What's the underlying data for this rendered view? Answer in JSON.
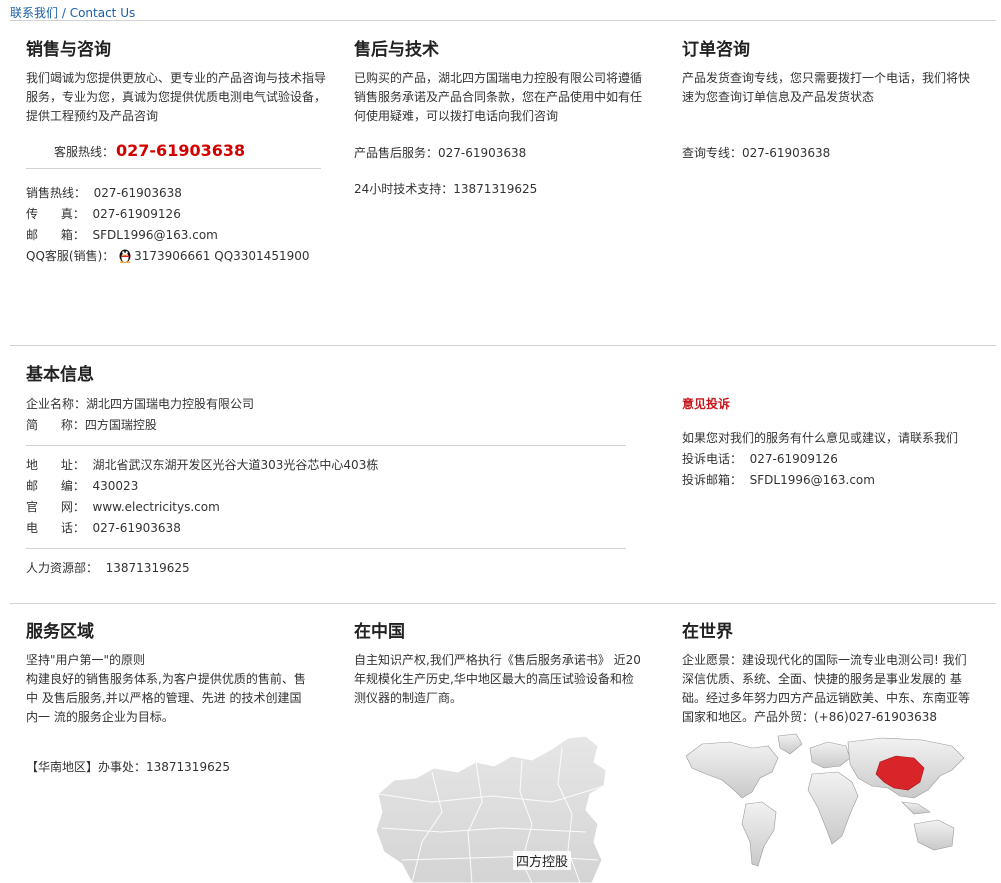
{
  "breadcrumb": {
    "cn": "联系我们",
    "sep": " / ",
    "en": "Contact Us"
  },
  "sales": {
    "title": "销售与咨询",
    "intro": "我们竭诚为您提供更放心、更专业的产品咨询与技术指导服务，专业为您，真诚为您提供优质电测电气试验设备，提供工程预约及产品咨询",
    "hotline_label": "客服热线：",
    "hotline_number": "027-61903638",
    "lines": [
      "销售热线：  027-61903638",
      "传      真：  027-61909126",
      "邮      箱：  SFDL1996@163.com"
    ],
    "qq_label": "QQ客服(销售)：",
    "qq_numbers": "3173906661 QQ3301451900"
  },
  "aftersales": {
    "title": "售后与技术",
    "intro": "已购买的产品，湖北四方国瑞电力控股有限公司将遵循销售服务承诺及产品合同条款，您在产品使用中如有任何使用疑难，可以拨打电话向我们咨询",
    "service": "产品售后服务：027-61903638",
    "support": "24小时技术支持：13871319625"
  },
  "order": {
    "title": "订单咨询",
    "intro": "产品发货查询专线，您只需要拨打一个电话，我们将快速为您查询订单信息及产品发货状态",
    "query": "查询专线：027-61903638"
  },
  "basic": {
    "title": "基本信息",
    "company": "企业名称：湖北四方国瑞电力控股有限公司",
    "short": "简      称：四方国瑞控股",
    "address": "地      址：  湖北省武汉东湖开发区光谷大道303光谷芯中心403栋",
    "postcode": "邮      编：  430023",
    "website": "官      网：  www.electricitys.com",
    "phone": "电      话：  027-61903638",
    "hr": "人力资源部：  13871319625"
  },
  "complaint": {
    "title": "意见投诉",
    "intro": "如果您对我们的服务有什么意见或建议，请联系我们",
    "phone": "投诉电话：  027-61909126",
    "email": "投诉邮箱：  SFDL1996@163.com"
  },
  "service_area": {
    "title": "服务区域",
    "line1": "坚持\"用户第一\"的原则",
    "body": "构建良好的销售服务体系,为客户提供优质的售前、售中 及售后服务,并以严格的管理、先进 的技术创建国内一 流的服务企业为目标。",
    "office": "【华南地区】办事处：13871319625"
  },
  "china": {
    "title": "在中国",
    "body": "自主知识产权,我们严格执行《售后服务承诺书》 近20年规模化生产历史,华中地区最大的高压试验设备和检测仪器的制造厂商。",
    "map_label": "四方控股"
  },
  "world": {
    "title": "在世界",
    "body": "企业愿景：建设现代化的国际一流专业电测公司! 我们深信优质、系统、全面、快捷的服务是事业发展的 基础。经过多年努力四方产品远销欧美、中东、东南亚等国家和地区。产品外贸：(+86)027-61903638"
  },
  "colors": {
    "link": "#1a5fa8",
    "hotline": "#d40000",
    "complaint": "#c8161d",
    "rule": "#d2d2d2",
    "highlight": "#d9252a"
  }
}
